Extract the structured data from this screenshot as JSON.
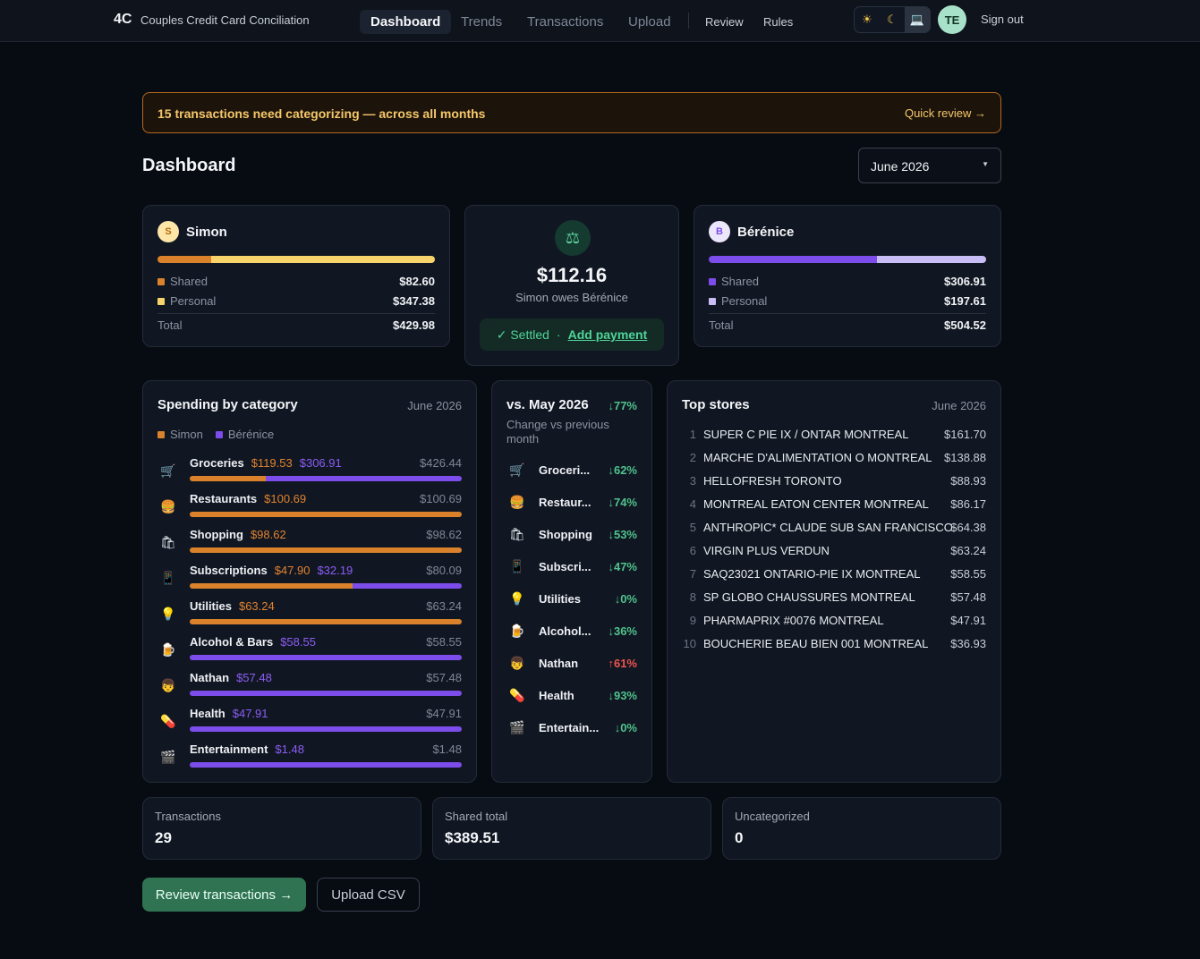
{
  "nav": {
    "logo_mark": "4C",
    "logo_text": "Couples Credit Card Conciliation",
    "tabs": [
      "Dashboard",
      "Trends",
      "Transactions",
      "Upload"
    ],
    "links": [
      "Review",
      "Rules"
    ],
    "theme": {
      "light": "☀",
      "dark": "☾",
      "system": "💻"
    },
    "avatar": "TE",
    "sign_out": "Sign out"
  },
  "banner": {
    "message": "15 transactions need categorizing — across all months",
    "action": "Quick review →"
  },
  "page": {
    "title": "Dashboard",
    "month": "June 2026"
  },
  "people": {
    "simon": {
      "initial": "S",
      "name": "Simon",
      "shared_label": "Shared",
      "shared": "$82.60",
      "personal_label": "Personal",
      "personal": "$347.38",
      "total_label": "Total",
      "total": "$429.98",
      "shared_fraction": 0.192,
      "colors": {
        "shared": "#d9822b",
        "personal": "#f7d46b"
      }
    },
    "berenice": {
      "initial": "B",
      "name": "Bérénice",
      "shared_label": "Shared",
      "shared": "$306.91",
      "personal_label": "Personal",
      "personal": "$197.61",
      "total_label": "Total",
      "total": "$504.52",
      "shared_fraction": 0.608,
      "colors": {
        "shared": "#7c4dea",
        "personal": "#c9bdf5"
      }
    }
  },
  "balance": {
    "icon": "scale-icon",
    "amount": "$112.16",
    "text": "Simon owes Bérénice",
    "settled": "✓ Settled",
    "dot": "·",
    "add_payment": "Add payment"
  },
  "spending": {
    "title": "Spending by category",
    "date": "June 2026",
    "legend": [
      "Simon",
      "Bérénice"
    ],
    "rows": [
      {
        "emoji": "🛒",
        "name": "Groceries",
        "simon": "$119.53",
        "berenice": "$306.91",
        "total": "$426.44",
        "simon_frac": 0.28
      },
      {
        "emoji": "🍔",
        "name": "Restaurants",
        "simon": "$100.69",
        "berenice": "",
        "total": "$100.69",
        "simon_frac": 1.0
      },
      {
        "emoji": "🛍",
        "name": "Shopping",
        "simon": "$98.62",
        "berenice": "",
        "total": "$98.62",
        "simon_frac": 1.0
      },
      {
        "emoji": "📱",
        "name": "Subscriptions",
        "simon": "$47.90",
        "berenice": "$32.19",
        "total": "$80.09",
        "simon_frac": 0.598
      },
      {
        "emoji": "💡",
        "name": "Utilities",
        "simon": "$63.24",
        "berenice": "",
        "total": "$63.24",
        "simon_frac": 1.0
      },
      {
        "emoji": "🍺",
        "name": "Alcohol & Bars",
        "simon": "",
        "berenice": "$58.55",
        "total": "$58.55",
        "simon_frac": 0.0
      },
      {
        "emoji": "👦",
        "name": "Nathan",
        "simon": "",
        "berenice": "$57.48",
        "total": "$57.48",
        "simon_frac": 0.0
      },
      {
        "emoji": "💊",
        "name": "Health",
        "simon": "",
        "berenice": "$47.91",
        "total": "$47.91",
        "simon_frac": 0.0
      },
      {
        "emoji": "🎬",
        "name": "Entertainment",
        "simon": "",
        "berenice": "$1.48",
        "total": "$1.48",
        "simon_frac": 0.0
      }
    ]
  },
  "comparison": {
    "title": "vs. May 2026",
    "change": "↓77%",
    "subtitle": "Change vs previous month",
    "rows": [
      {
        "emoji": "🛒",
        "name": "Groceri...",
        "pct": "↓62%",
        "dir": "down"
      },
      {
        "emoji": "🍔",
        "name": "Restaur...",
        "pct": "↓74%",
        "dir": "down"
      },
      {
        "emoji": "🛍",
        "name": "Shopping",
        "pct": "↓53%",
        "dir": "down"
      },
      {
        "emoji": "📱",
        "name": "Subscri...",
        "pct": "↓47%",
        "dir": "down"
      },
      {
        "emoji": "💡",
        "name": "Utilities",
        "pct": "↓0%",
        "dir": "down"
      },
      {
        "emoji": "🍺",
        "name": "Alcohol...",
        "pct": "↓36%",
        "dir": "down"
      },
      {
        "emoji": "👦",
        "name": "Nathan",
        "pct": "↑61%",
        "dir": "up"
      },
      {
        "emoji": "💊",
        "name": "Health",
        "pct": "↓93%",
        "dir": "down"
      },
      {
        "emoji": "🎬",
        "name": "Entertain...",
        "pct": "↓0%",
        "dir": "down"
      }
    ]
  },
  "stores": {
    "title": "Top stores",
    "date": "June 2026",
    "rows": [
      {
        "n": "1",
        "name": "SUPER C PIE IX / ONTAR MONTREAL",
        "amount": "$161.70"
      },
      {
        "n": "2",
        "name": "MARCHE D'ALIMENTATION O MONTREAL",
        "amount": "$138.88"
      },
      {
        "n": "3",
        "name": "HELLOFRESH TORONTO",
        "amount": "$88.93"
      },
      {
        "n": "4",
        "name": "MONTREAL EATON CENTER MONTREAL",
        "amount": "$86.17"
      },
      {
        "n": "5",
        "name": "ANTHROPIC* CLAUDE SUB SAN FRANCISCO",
        "amount": "$64.38"
      },
      {
        "n": "6",
        "name": "VIRGIN PLUS VERDUN",
        "amount": "$63.24"
      },
      {
        "n": "7",
        "name": "SAQ23021 ONTARIO-PIE IX MONTREAL",
        "amount": "$58.55"
      },
      {
        "n": "8",
        "name": "SP GLOBO CHAUSSURES MONTREAL",
        "amount": "$57.48"
      },
      {
        "n": "9",
        "name": "PHARMAPRIX #0076 MONTREAL",
        "amount": "$47.91"
      },
      {
        "n": "10",
        "name": "BOUCHERIE BEAU BIEN 001 MONTREAL",
        "amount": "$36.93"
      }
    ]
  },
  "stats": [
    {
      "label": "Transactions",
      "value": "29"
    },
    {
      "label": "Shared total",
      "value": "$389.51"
    },
    {
      "label": "Uncategorized",
      "value": "0"
    }
  ],
  "actions": {
    "review": "Review transactions →",
    "upload": "Upload CSV"
  }
}
